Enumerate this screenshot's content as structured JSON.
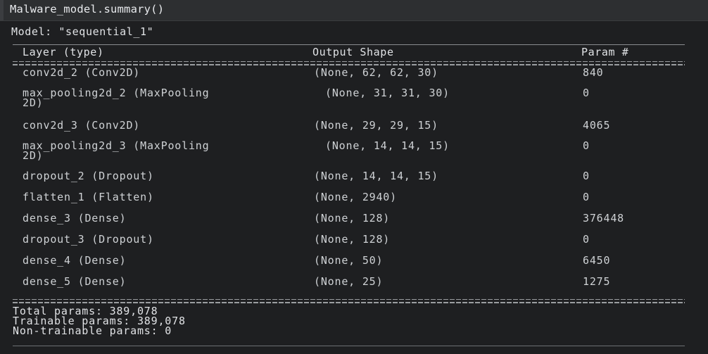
{
  "code_cell": {
    "code": "Malware_model.summary()"
  },
  "summary": {
    "model_line": "Model: \"sequential_1\"",
    "headers": {
      "layer": "Layer (type)",
      "output": "Output Shape",
      "param": "Param #"
    },
    "rows": [
      {
        "layer": "conv2d_2 (Conv2D)",
        "output": "(None, 62, 62, 30)",
        "param": "840"
      },
      {
        "layer": "max_pooling2d_2 (MaxPooling\n2D)",
        "output": "(None, 31, 31, 30)",
        "param": "0"
      },
      {
        "layer": "conv2d_3 (Conv2D)",
        "output": "(None, 29, 29, 15)",
        "param": "4065"
      },
      {
        "layer": "max_pooling2d_3 (MaxPooling\n2D)",
        "output": "(None, 14, 14, 15)",
        "param": "0"
      },
      {
        "layer": "dropout_2 (Dropout)",
        "output": "(None, 14, 14, 15)",
        "param": "0"
      },
      {
        "layer": "flatten_1 (Flatten)",
        "output": "(None, 2940)",
        "param": "0"
      },
      {
        "layer": "dense_3 (Dense)",
        "output": "(None, 128)",
        "param": "376448"
      },
      {
        "layer": "dropout_3 (Dropout)",
        "output": "(None, 128)",
        "param": "0"
      },
      {
        "layer": "dense_4 (Dense)",
        "output": "(None, 50)",
        "param": "6450"
      },
      {
        "layer": "dense_5 (Dense)",
        "output": "(None, 25)",
        "param": "1275"
      }
    ],
    "totals": {
      "total": "Total params: 389,078",
      "trainable": "Trainable params: 389,078",
      "non_trainable": "Non-trainable params: 0"
    }
  }
}
